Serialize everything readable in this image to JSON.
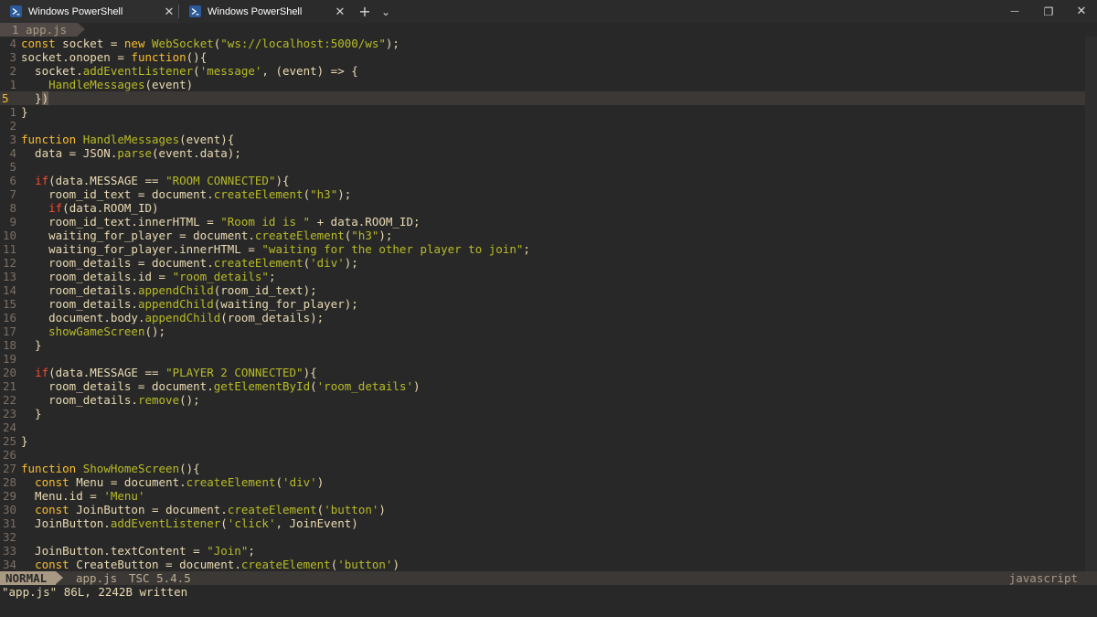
{
  "window": {
    "tabs": [
      {
        "label": "Windows PowerShell",
        "active": true
      },
      {
        "label": "Windows PowerShell",
        "active": false
      }
    ],
    "new_tab": "+",
    "dropdown": "⌄",
    "minimize": "—",
    "maximize": "❐",
    "close": "✕",
    "tab_close": "✕"
  },
  "buffer": {
    "label": "1 app.js"
  },
  "lines": [
    {
      "n": "4",
      "code": "const socket = new WebSocket(\"ws://localhost:5000/ws\");"
    },
    {
      "n": "3",
      "code": "socket.onopen = function(){"
    },
    {
      "n": "2",
      "code": "  socket.addEventListener('message', (event) => {"
    },
    {
      "n": "1",
      "code": "    HandleMessages(event)"
    },
    {
      "n": "5",
      "code": "  })",
      "current": true
    },
    {
      "n": "1",
      "code": "}"
    },
    {
      "n": "2",
      "code": ""
    },
    {
      "n": "3",
      "code": "function HandleMessages(event){"
    },
    {
      "n": "4",
      "code": "  data = JSON.parse(event.data);"
    },
    {
      "n": "5",
      "code": ""
    },
    {
      "n": "6",
      "code": "  if(data.MESSAGE == \"ROOM CONNECTED\"){"
    },
    {
      "n": "7",
      "code": "    room_id_text = document.createElement(\"h3\");"
    },
    {
      "n": "8",
      "code": "    if(data.ROOM_ID)"
    },
    {
      "n": "9",
      "code": "    room_id_text.innerHTML = \"Room id is \" + data.ROOM_ID;"
    },
    {
      "n": "10",
      "code": "    waiting_for_player = document.createElement(\"h3\");"
    },
    {
      "n": "11",
      "code": "    waiting_for_player.innerHTML = \"waiting for the other player to join\";"
    },
    {
      "n": "12",
      "code": "    room_details = document.createElement('div');"
    },
    {
      "n": "13",
      "code": "    room_details.id = \"room_details\";"
    },
    {
      "n": "14",
      "code": "    room_details.appendChild(room_id_text);"
    },
    {
      "n": "15",
      "code": "    room_details.appendChild(waiting_for_player);"
    },
    {
      "n": "16",
      "code": "    document.body.appendChild(room_details);"
    },
    {
      "n": "17",
      "code": "    showGameScreen();"
    },
    {
      "n": "18",
      "code": "  }"
    },
    {
      "n": "19",
      "code": ""
    },
    {
      "n": "20",
      "code": "  if(data.MESSAGE == \"PLAYER 2 CONNECTED\"){"
    },
    {
      "n": "21",
      "code": "    room_details = document.getElementById('room_details')"
    },
    {
      "n": "22",
      "code": "    room_details.remove();"
    },
    {
      "n": "23",
      "code": "  }"
    },
    {
      "n": "24",
      "code": ""
    },
    {
      "n": "25",
      "code": "}"
    },
    {
      "n": "26",
      "code": ""
    },
    {
      "n": "27",
      "code": "function ShowHomeScreen(){"
    },
    {
      "n": "28",
      "code": "  const Menu = document.createElement('div')"
    },
    {
      "n": "29",
      "code": "  Menu.id = 'Menu'"
    },
    {
      "n": "30",
      "code": "  const JoinButton = document.createElement('button')"
    },
    {
      "n": "31",
      "code": "  JoinButton.addEventListener('click', JoinEvent)"
    },
    {
      "n": "32",
      "code": ""
    },
    {
      "n": "33",
      "code": "  JoinButton.textContent = \"Join\";"
    },
    {
      "n": "34",
      "code": "  const CreateButton = document.createElement('button')"
    }
  ],
  "status": {
    "mode": "NORMAL",
    "file": "app.js",
    "lsp": "TSC 5.4.5",
    "filetype": "javascript"
  },
  "cmdline": "\"app.js\" 86L, 2242B written",
  "colors": {
    "background": "#282828",
    "keyword": "#fb4934",
    "string": "#b8bb26",
    "function": "#b8bb26",
    "builtin": "#8ec07c",
    "accent": "#fabd2f"
  }
}
